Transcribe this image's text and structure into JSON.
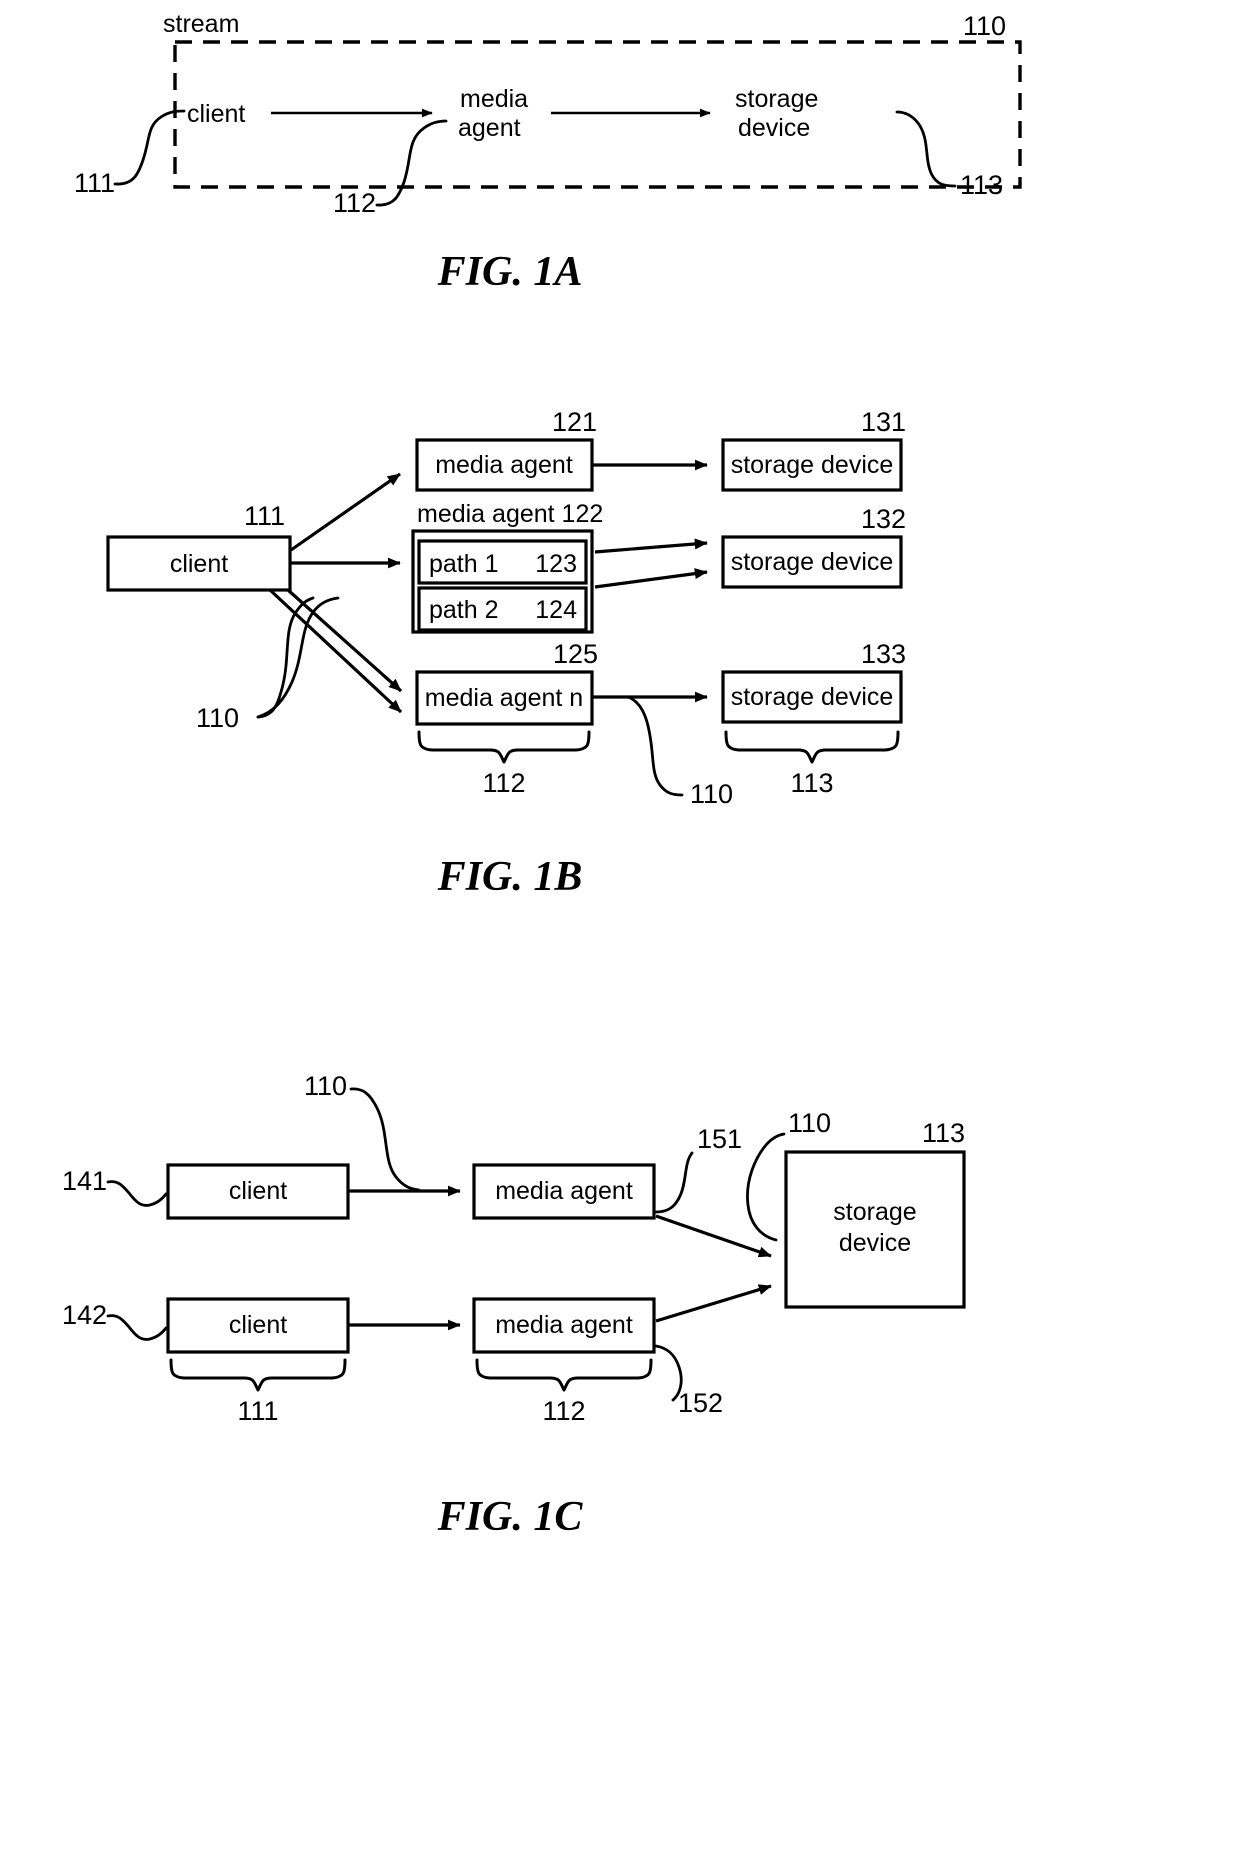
{
  "document": {
    "type": "patent-figure-sheet",
    "figures": [
      "FIG. 1A",
      "FIG. 1B",
      "FIG. 1C"
    ]
  },
  "fig1a": {
    "caption": "FIG. 1A",
    "stream_label": "stream",
    "nodes": [
      {
        "id": "client",
        "label": "client"
      },
      {
        "id": "media-agent",
        "label_line1": "media",
        "label_line2": "agent"
      },
      {
        "id": "storage-device",
        "label_line1": "storage",
        "label_line2": "device"
      }
    ],
    "ref_numerals": {
      "client": "111",
      "media_agent": "112",
      "storage_device": "113",
      "stream": "110"
    }
  },
  "fig1b": {
    "caption": "FIG. 1B",
    "client": {
      "label": "client",
      "ref": "111"
    },
    "media_agents": [
      {
        "label": "media agent",
        "ref": "121"
      },
      {
        "label": "media agent 122",
        "ref": "122",
        "paths": [
          {
            "label": "path 1",
            "ref": "123"
          },
          {
            "label": "path 2",
            "ref": "124"
          }
        ]
      },
      {
        "label": "media agent n",
        "ref": "125"
      }
    ],
    "storage_devices": [
      {
        "label": "storage device",
        "ref": "131"
      },
      {
        "label": "storage device",
        "ref": "132"
      },
      {
        "label": "storage device",
        "ref": "133"
      }
    ],
    "brace_labels": {
      "media_agents_group": "112",
      "storage_devices_group": "113"
    },
    "stream_refs": {
      "left": "110",
      "right": "110"
    }
  },
  "fig1c": {
    "caption": "FIG. 1C",
    "rows": [
      {
        "client": {
          "label": "client",
          "ref": "141"
        },
        "media_agent": {
          "label": "media agent"
        },
        "stream_ref": "110",
        "link_ref": "151"
      },
      {
        "client": {
          "label": "client",
          "ref": "142"
        },
        "media_agent": {
          "label": "media agent"
        },
        "link_ref": "152"
      }
    ],
    "storage_device": {
      "label_line1": "storage",
      "label_line2": "device",
      "ref": "113"
    },
    "stream_ref_right": "110",
    "brace_labels": {
      "clients_group": "111",
      "media_agents_group": "112"
    }
  },
  "colors": {
    "ink": "#000000",
    "background": "#ffffff"
  }
}
